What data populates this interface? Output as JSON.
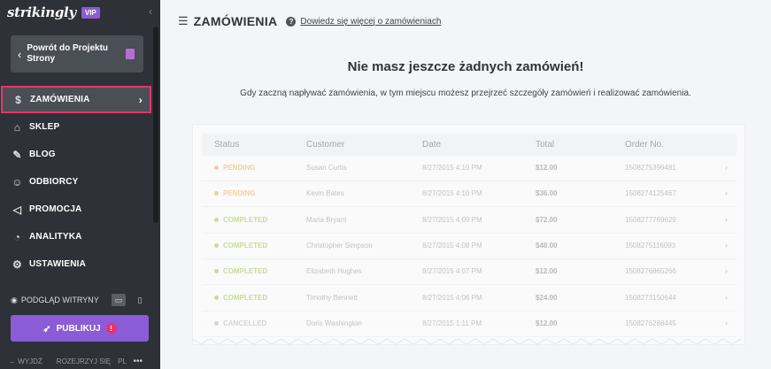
{
  "sidebar": {
    "logo": "strikingly",
    "vip_badge": "VIP",
    "back_button": "Powrót do Projektu Strony",
    "items": [
      {
        "label": "ZAMÓWIENIA",
        "icon": "dollar-circle-icon",
        "active": true
      },
      {
        "label": "SKLEP",
        "icon": "store-icon",
        "active": false
      },
      {
        "label": "BLOG",
        "icon": "quill-icon",
        "active": false
      },
      {
        "label": "ODBIORCY",
        "icon": "users-icon",
        "active": false
      },
      {
        "label": "PROMOCJA",
        "icon": "megaphone-icon",
        "active": false
      },
      {
        "label": "ANALITYKA",
        "icon": "pie-chart-icon",
        "active": false
      },
      {
        "label": "USTAWIENIA",
        "icon": "gear-icon",
        "active": false
      }
    ],
    "preview_label": "PODGLĄD WITRYNY",
    "publish_label": "PUBLIKUJ",
    "footer": {
      "exit": "WYJDŹ",
      "explore": "ROZEJRZYJ SIĘ",
      "lang": "PL",
      "more": "•••"
    }
  },
  "main": {
    "title": "ZAMÓWIENIA",
    "help_link": "Dowiedz się więcej o zamówieniach",
    "empty_title": "Nie masz jeszcze żadnych zamówień!",
    "empty_desc": "Gdy zaczną napływać zamówienia, w tym miejscu możesz przejrzeć szczegóły zamówień i realizować zamówienia.",
    "table": {
      "headers": [
        "Status",
        "Customer",
        "Date",
        "Total",
        "Order No."
      ],
      "rows": [
        {
          "status": "PENDING",
          "customer": "Susan Curtis",
          "date": "8/27/2015 4:10 PM",
          "total": "$12.00",
          "order": "1508275396481"
        },
        {
          "status": "PENDING",
          "customer": "Kevin Bates",
          "date": "8/27/2015 4:10 PM",
          "total": "$36.00",
          "order": "1508274125467"
        },
        {
          "status": "COMPLETED",
          "customer": "Maria Bryant",
          "date": "8/27/2015 4:09 PM",
          "total": "$72.00",
          "order": "1508277769629"
        },
        {
          "status": "COMPLETED",
          "customer": "Christopher Simpson",
          "date": "8/27/2015 4:08 PM",
          "total": "$48.00",
          "order": "1508275116093"
        },
        {
          "status": "COMPLETED",
          "customer": "Elizabeth Hughes",
          "date": "8/27/2015 4:07 PM",
          "total": "$12.00",
          "order": "1508276865266"
        },
        {
          "status": "COMPLETED",
          "customer": "Timothy Bennett",
          "date": "8/27/2015 4:06 PM",
          "total": "$24.00",
          "order": "1508273150644"
        },
        {
          "status": "CANCELLED",
          "customer": "Doris Washington",
          "date": "8/27/2015 1:11 PM",
          "total": "$12.00",
          "order": "1508276288445"
        }
      ]
    }
  },
  "colors": {
    "sidebar_bg": "#2e3137",
    "accent_purple": "#8a5cd6",
    "active_border": "#e8336d",
    "pending": "#f0b24a",
    "completed": "#a6c84a",
    "cancelled": "#bbbbbb"
  }
}
